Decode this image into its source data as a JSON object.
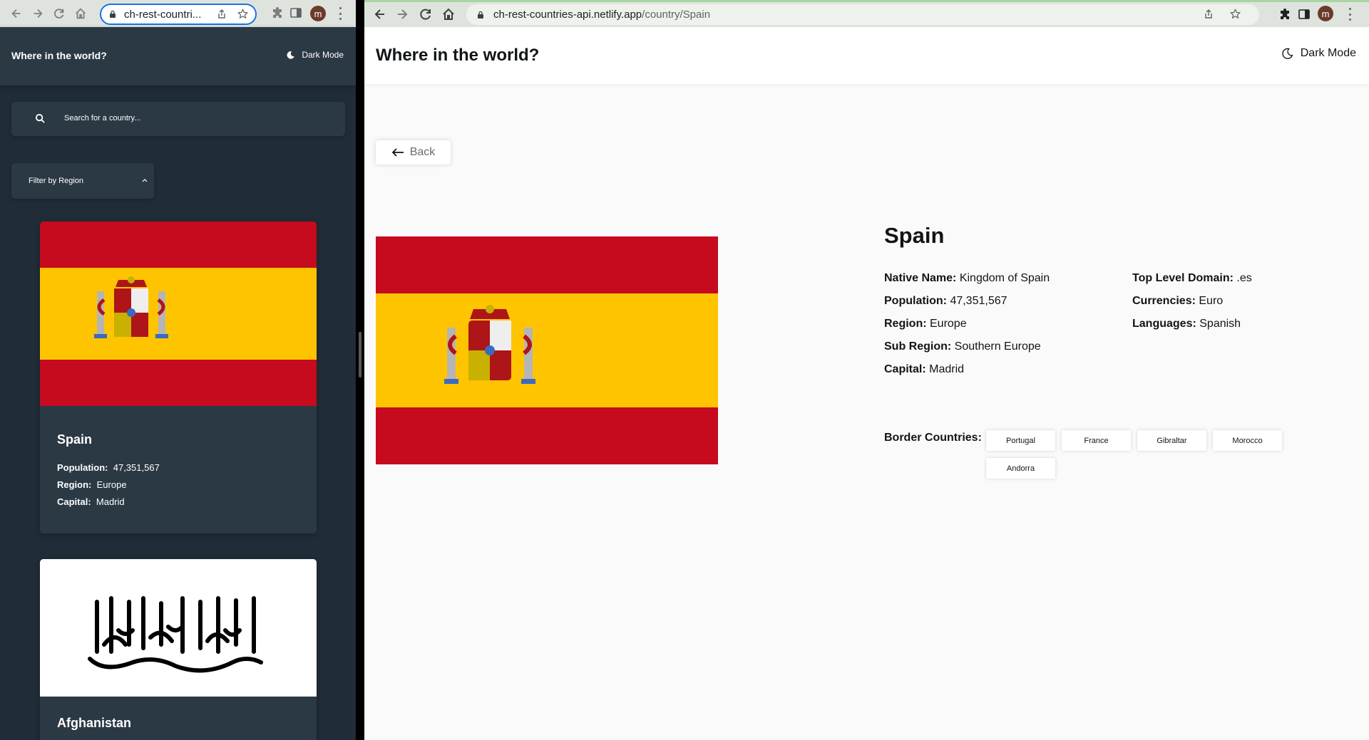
{
  "left_window": {
    "tab_url": "ch-rest-countri...",
    "avatar_letter": "m",
    "header": {
      "title": "Where in the world?",
      "mode_toggle": "Dark Mode"
    },
    "search": {
      "placeholder": "Search for a country..."
    },
    "filter": {
      "label": "Filter by Region"
    },
    "cards": [
      {
        "name": "Spain",
        "population_label": "Population:",
        "population": "47,351,567",
        "region_label": "Region:",
        "region": "Europe",
        "capital_label": "Capital:",
        "capital": "Madrid"
      },
      {
        "name": "Afghanistan"
      }
    ]
  },
  "right_window": {
    "url_host": "ch-rest-countries-api.netlify.app",
    "url_path": "/country/Spain",
    "avatar_letter": "m",
    "header": {
      "title": "Where in the world?",
      "mode_toggle": "Dark Mode"
    },
    "back_label": "Back",
    "country": {
      "name": "Spain",
      "native_name_label": "Native Name:",
      "native_name": "Kingdom of Spain",
      "population_label": "Population:",
      "population": "47,351,567",
      "region_label": "Region:",
      "region": "Europe",
      "sub_region_label": "Sub Region:",
      "sub_region": "Southern Europe",
      "capital_label": "Capital:",
      "capital": "Madrid",
      "tld_label": "Top Level Domain:",
      "tld": ".es",
      "currencies_label": "Currencies:",
      "currencies": "Euro",
      "languages_label": "Languages:",
      "languages": "Spanish",
      "border_countries_label": "Border Countries:",
      "border_countries": [
        "Portugal",
        "France",
        "Gibraltar",
        "Morocco",
        "Andorra"
      ]
    }
  },
  "colors": {
    "dark_bg": "#202c37",
    "dark_element": "#2b3945",
    "light_bg": "#fafafa",
    "flag_red": "#c60b1e",
    "flag_yellow": "#ffc400"
  }
}
